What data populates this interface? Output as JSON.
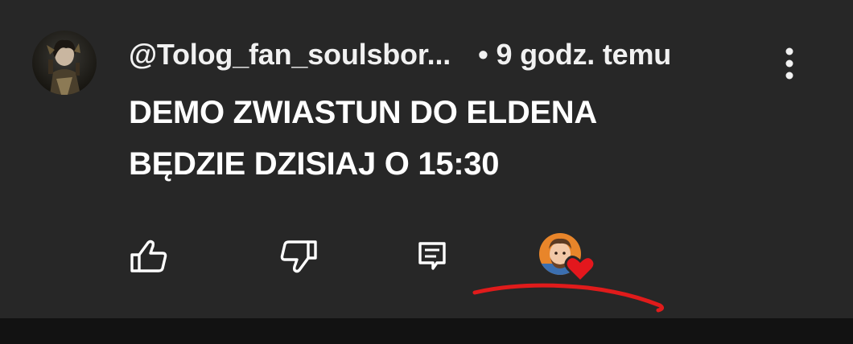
{
  "comment": {
    "author": "@Tolog_fan_soulsbor...",
    "separator": "•",
    "time_ago": "9 godz. temu",
    "text_line1": "DEMO ZWIASTUN DO ELDENA",
    "text_line2": "BĘDZIE DZISIAJ O 15:30"
  },
  "icons": {
    "menu": "vertical-dots-icon",
    "like": "thumbs-up-icon",
    "dislike": "thumbs-down-icon",
    "reply": "comment-icon",
    "creator_heart": "creator-heart-icon"
  },
  "colors": {
    "background": "#272727",
    "text": "#ffffff",
    "heart": "#e3171d",
    "annotation": "#e01b1b"
  }
}
